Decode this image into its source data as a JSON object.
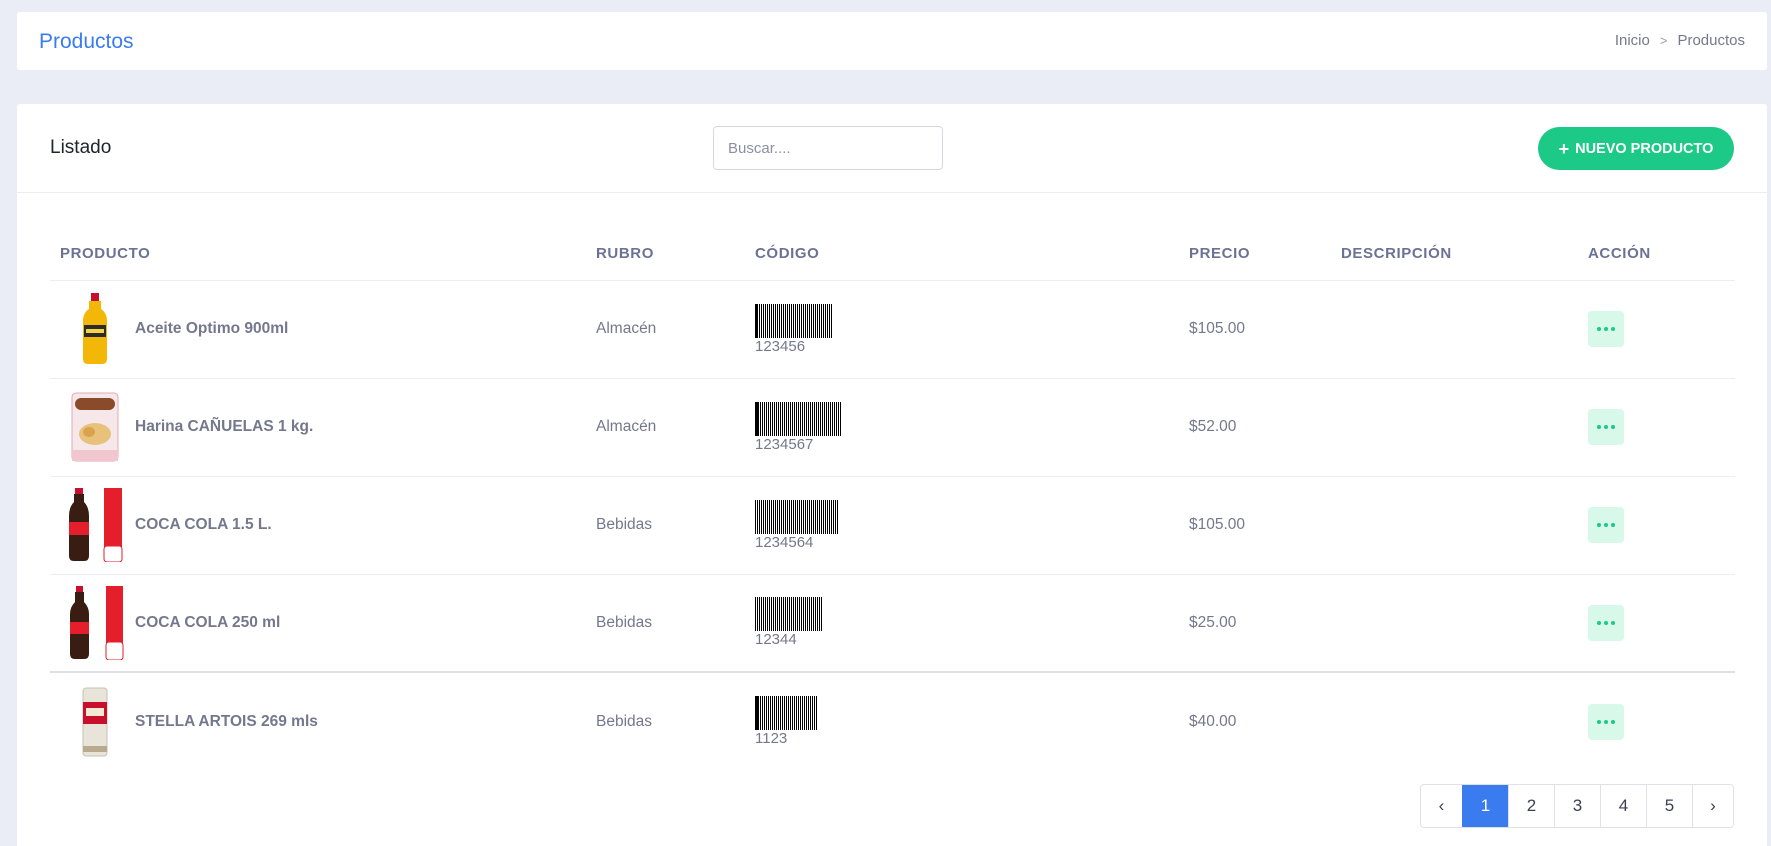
{
  "header": {
    "title": "Productos",
    "breadcrumb": [
      "Inicio",
      "Productos"
    ]
  },
  "card": {
    "title": "Listado",
    "search_placeholder": "Buscar....",
    "new_button": "NUEVO PRODUCTO"
  },
  "table": {
    "columns": [
      "PRODUCTO",
      "RUBRO",
      "CÓDIGO",
      "PRECIO",
      "DESCRIPCIÓN",
      "ACCIÓN"
    ],
    "rows": [
      {
        "name": "Aceite Optimo 900ml",
        "rubro": "Almacén",
        "codigo": "123456",
        "precio": "$105.00",
        "descripcion": "",
        "thumb": "oil"
      },
      {
        "name": "Harina CAÑUELAS 1 kg.",
        "rubro": "Almacén",
        "codigo": "1234567",
        "precio": "$52.00",
        "descripcion": "",
        "thumb": "flour"
      },
      {
        "name": "COCA COLA 1.5 L.",
        "rubro": "Bebidas",
        "codigo": "1234564",
        "precio": "$105.00",
        "descripcion": "",
        "thumb": "coke-big"
      },
      {
        "name": "COCA COLA 250 ml",
        "rubro": "Bebidas",
        "codigo": "12344",
        "precio": "$25.00",
        "descripcion": "",
        "thumb": "coke-small"
      },
      {
        "name": "STELLA ARTOIS  269 mls",
        "rubro": "Bebidas",
        "codigo": "1123",
        "precio": "$40.00",
        "descripcion": "",
        "thumb": "can"
      }
    ]
  },
  "pagination": {
    "prev": "‹",
    "pages": [
      "1",
      "2",
      "3",
      "4",
      "5"
    ],
    "next": "›",
    "active": "1"
  },
  "colors": {
    "accent": "#3a7bf0",
    "success": "#1dc987"
  }
}
